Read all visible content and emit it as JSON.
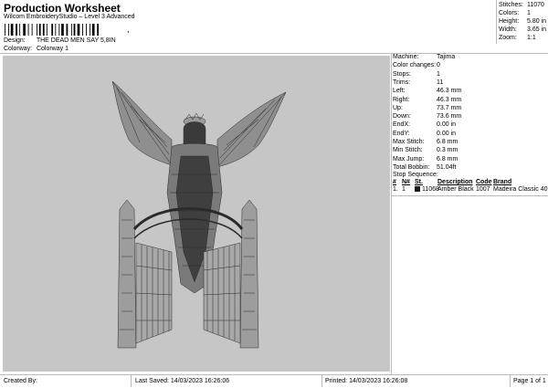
{
  "header": {
    "title": "Production Worksheet",
    "subtitle": "Wilcom EmbroideryStudio – Level 3 Advanced",
    "barcode_suffix": ","
  },
  "meta": {
    "design_label": "Design:",
    "design_value": "THE DEAD MEN SAY 5,8IN",
    "colorway_label": "Colorway:",
    "colorway_value": "Colorway 1"
  },
  "stats": [
    {
      "label": "Stitches:",
      "value": "11070"
    },
    {
      "label": "Colors:",
      "value": "1"
    },
    {
      "label": "Height:",
      "value": "5.80 in"
    },
    {
      "label": "Width:",
      "value": "3.65 in"
    },
    {
      "label": "Zoom:",
      "value": "1:1"
    }
  ],
  "details": [
    {
      "label": "Machine:",
      "value": "Tajima"
    },
    {
      "label": "Color changes:",
      "value": "0"
    },
    {
      "label": "Stops:",
      "value": "1"
    },
    {
      "label": "Trims:",
      "value": "11"
    },
    {
      "label": "Left:",
      "value": "46.3 mm"
    },
    {
      "label": "Right:",
      "value": "46.3 mm"
    },
    {
      "label": "Up:",
      "value": "73.7 mm"
    },
    {
      "label": "Down:",
      "value": "73.6 mm"
    },
    {
      "label": "EndX:",
      "value": "0.00 in"
    },
    {
      "label": "EndY:",
      "value": "0.00 in"
    },
    {
      "label": "Max Stitch:",
      "value": "6.8 mm"
    },
    {
      "label": "Min Stitch:",
      "value": "0.3 mm"
    },
    {
      "label": "Max Jump:",
      "value": "6.8 mm"
    },
    {
      "label": "Total Bobbin:",
      "value": "51.04ft"
    }
  ],
  "sequence": {
    "title": "Stop Sequence:",
    "headers": {
      "num": "#",
      "n": "N#",
      "st": "St.",
      "description": "Description",
      "code": "Code",
      "brand": "Brand"
    },
    "rows": [
      {
        "num": "1.",
        "n": "1",
        "st": "11068",
        "description": "Amber Black",
        "code": "1007",
        "brand": "Madeira Classic 40",
        "color": "#1a1a1a"
      }
    ]
  },
  "footer": {
    "created": "Created By:",
    "last_saved": "Last Saved: 14/03/2023 16:26:06",
    "printed": "Printed: 14/03/2023 16:26:08",
    "page": "Page 1 of 1"
  },
  "colors": {
    "design_bg": "#c6c6c6",
    "thread": "#1a1a1a"
  }
}
